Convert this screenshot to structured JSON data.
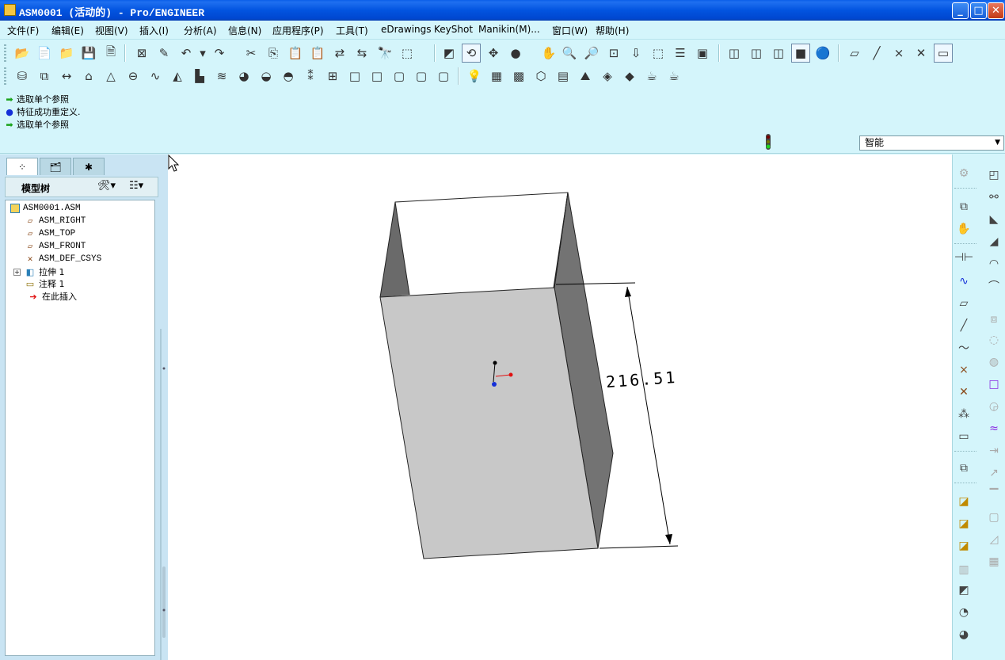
{
  "window": {
    "title": "ASM0001 (活动的) - Pro/ENGINEER",
    "minimize_label": "_",
    "maximize_label": "□",
    "close_label": "✕"
  },
  "menu": [
    "文件(F)",
    "编辑(E)",
    "视图(V)",
    "插入(I)",
    "分析(A)",
    "信息(N)",
    "应用程序(P)",
    "工具(T)",
    "eDrawings",
    "KeyShot",
    "Manikin(M)...",
    "窗口(W)",
    "帮助(H)"
  ],
  "messages": [
    {
      "icon": "green-arrow",
      "text": "选取单个参照"
    },
    {
      "icon": "blue-dot",
      "text": "特征成功重定义."
    },
    {
      "icon": "green-arrow",
      "text": "选取单个参照"
    }
  ],
  "filter": {
    "value": "智能"
  },
  "model_tree": {
    "header": "模型树",
    "items": [
      {
        "label": "ASM0001.ASM",
        "icon": "assembly-icon"
      },
      {
        "label": "ASM_RIGHT",
        "icon": "datum-plane-icon"
      },
      {
        "label": "ASM_TOP",
        "icon": "datum-plane-icon"
      },
      {
        "label": "ASM_FRONT",
        "icon": "datum-plane-icon"
      },
      {
        "label": "ASM_DEF_CSYS",
        "icon": "csys-icon"
      },
      {
        "label": "拉伸 1",
        "icon": "extrude-icon"
      },
      {
        "label": "注释 1",
        "icon": "note-icon"
      },
      {
        "label": "在此插入",
        "icon": "insert-here-icon"
      }
    ]
  },
  "graphics": {
    "dimension_text": "216.51",
    "colors": {
      "front_face": "#c8c8c8",
      "side_face": "#6e6e6e",
      "inner_face": "#5a5a5a",
      "background": "#ffffff"
    }
  }
}
